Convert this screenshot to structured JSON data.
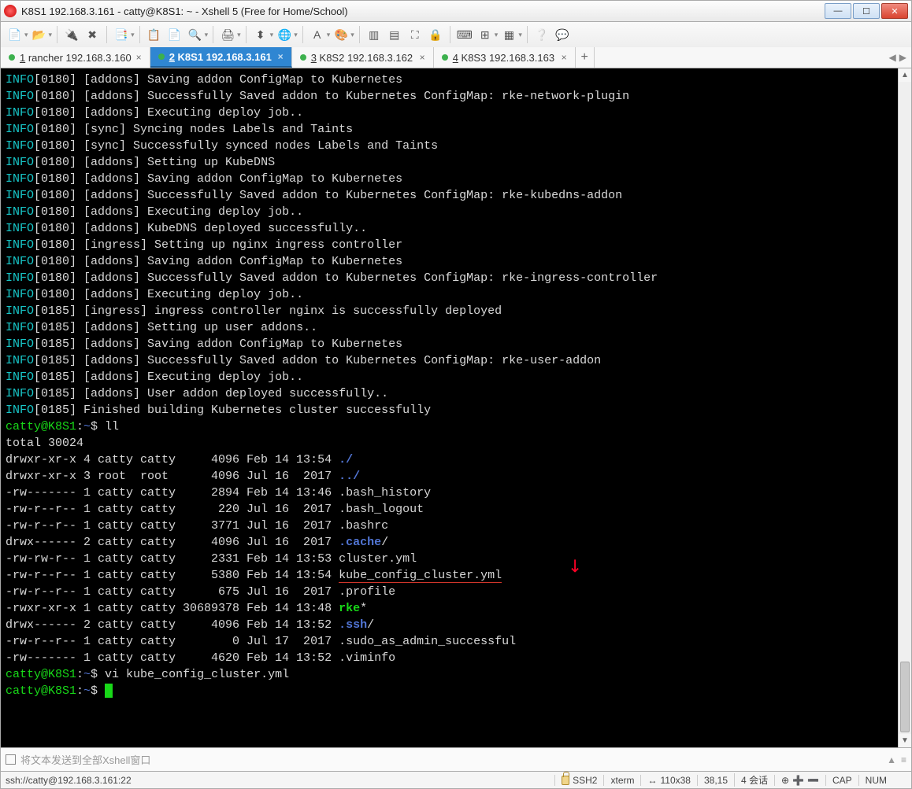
{
  "window": {
    "title": "K8S1 192.168.3.161 - catty@K8S1: ~ - Xshell 5 (Free for Home/School)"
  },
  "tabs": [
    {
      "n": "1",
      "label": "rancher 192.168.3.160",
      "active": false
    },
    {
      "n": "2",
      "label": "K8S1 192.168.3.161",
      "active": true
    },
    {
      "n": "3",
      "label": "K8S2 192.168.3.162",
      "active": false
    },
    {
      "n": "4",
      "label": "K8S3 192.168.3.163",
      "active": false
    }
  ],
  "terminal": {
    "info_lines": [
      {
        "t": "0180",
        "m": "[addons] Saving addon ConfigMap to Kubernetes"
      },
      {
        "t": "0180",
        "m": "[addons] Successfully Saved addon to Kubernetes ConfigMap: rke-network-plugin"
      },
      {
        "t": "0180",
        "m": "[addons] Executing deploy job.."
      },
      {
        "t": "0180",
        "m": "[sync] Syncing nodes Labels and Taints"
      },
      {
        "t": "0180",
        "m": "[sync] Successfully synced nodes Labels and Taints"
      },
      {
        "t": "0180",
        "m": "[addons] Setting up KubeDNS"
      },
      {
        "t": "0180",
        "m": "[addons] Saving addon ConfigMap to Kubernetes"
      },
      {
        "t": "0180",
        "m": "[addons] Successfully Saved addon to Kubernetes ConfigMap: rke-kubedns-addon"
      },
      {
        "t": "0180",
        "m": "[addons] Executing deploy job.."
      },
      {
        "t": "0180",
        "m": "[addons] KubeDNS deployed successfully.."
      },
      {
        "t": "0180",
        "m": "[ingress] Setting up nginx ingress controller"
      },
      {
        "t": "0180",
        "m": "[addons] Saving addon ConfigMap to Kubernetes"
      },
      {
        "t": "0180",
        "m": "[addons] Successfully Saved addon to Kubernetes ConfigMap: rke-ingress-controller"
      },
      {
        "t": "0180",
        "m": "[addons] Executing deploy job.."
      },
      {
        "t": "0185",
        "m": "[ingress] ingress controller nginx is successfully deployed"
      },
      {
        "t": "0185",
        "m": "[addons] Setting up user addons.."
      },
      {
        "t": "0185",
        "m": "[addons] Saving addon ConfigMap to Kubernetes"
      },
      {
        "t": "0185",
        "m": "[addons] Successfully Saved addon to Kubernetes ConfigMap: rke-user-addon"
      },
      {
        "t": "0185",
        "m": "[addons] Executing deploy job.."
      },
      {
        "t": "0185",
        "m": "[addons] User addon deployed successfully.."
      },
      {
        "t": "0185",
        "m": "Finished building Kubernetes cluster successfully"
      }
    ],
    "prompt": "catty@K8S1",
    "path": "~",
    "cmd1": "ll",
    "total": "total 30024",
    "ls": [
      {
        "perm": "drwxr-xr-x",
        "l": "4",
        "o": "catty",
        "g": "catty",
        "sz": "4096",
        "dt": "Feb 14 13:54",
        "name": "./",
        "cls": "c-dir"
      },
      {
        "perm": "drwxr-xr-x",
        "l": "3",
        "o": "root ",
        "g": "root ",
        "sz": "4096",
        "dt": "Jul 16  2017",
        "name": "../",
        "cls": "c-dir"
      },
      {
        "perm": "-rw-------",
        "l": "1",
        "o": "catty",
        "g": "catty",
        "sz": "2894",
        "dt": "Feb 14 13:46",
        "name": ".bash_history",
        "cls": ""
      },
      {
        "perm": "-rw-r--r--",
        "l": "1",
        "o": "catty",
        "g": "catty",
        "sz": "220",
        "dt": "Jul 16  2017",
        "name": ".bash_logout",
        "cls": ""
      },
      {
        "perm": "-rw-r--r--",
        "l": "1",
        "o": "catty",
        "g": "catty",
        "sz": "3771",
        "dt": "Jul 16  2017",
        "name": ".bashrc",
        "cls": ""
      },
      {
        "perm": "drwx------",
        "l": "2",
        "o": "catty",
        "g": "catty",
        "sz": "4096",
        "dt": "Jul 16  2017",
        "name": ".cache",
        "suffix": "/",
        "cls": "c-dir"
      },
      {
        "perm": "-rw-rw-r--",
        "l": "1",
        "o": "catty",
        "g": "catty",
        "sz": "2331",
        "dt": "Feb 14 13:53",
        "name": "cluster.yml",
        "cls": ""
      },
      {
        "perm": "-rw-r--r--",
        "l": "1",
        "o": "catty",
        "g": "catty",
        "sz": "5380",
        "dt": "Feb 14 13:54",
        "name": "kube_config_cluster.yml",
        "cls": "",
        "ul": true
      },
      {
        "perm": "-rw-r--r--",
        "l": "1",
        "o": "catty",
        "g": "catty",
        "sz": "675",
        "dt": "Jul 16  2017",
        "name": ".profile",
        "cls": ""
      },
      {
        "perm": "-rwxr-xr-x",
        "l": "1",
        "o": "catty",
        "g": "catty",
        "sz": "30689378",
        "dt": "Feb 14 13:48",
        "name": "rke",
        "suffix": "*",
        "cls": "c-exe"
      },
      {
        "perm": "drwx------",
        "l": "2",
        "o": "catty",
        "g": "catty",
        "sz": "4096",
        "dt": "Feb 14 13:52",
        "name": ".ssh",
        "suffix": "/",
        "cls": "c-dir"
      },
      {
        "perm": "-rw-r--r--",
        "l": "1",
        "o": "catty",
        "g": "catty",
        "sz": "0",
        "dt": "Jul 17  2017",
        "name": ".sudo_as_admin_successful",
        "cls": ""
      },
      {
        "perm": "-rw-------",
        "l": "1",
        "o": "catty",
        "g": "catty",
        "sz": "4620",
        "dt": "Feb 14 13:52",
        "name": ".viminfo",
        "cls": ""
      }
    ],
    "cmd2": "vi kube_config_cluster.yml"
  },
  "sendbar": {
    "placeholder": "将文本发送到全部Xshell窗口"
  },
  "status": {
    "conn": "ssh://catty@192.168.3.161:22",
    "proto": "SSH2",
    "term": "xterm",
    "size": "110x38",
    "pos": "38,15",
    "sessions": "4 会话",
    "cap": "CAP",
    "num": "NUM"
  }
}
